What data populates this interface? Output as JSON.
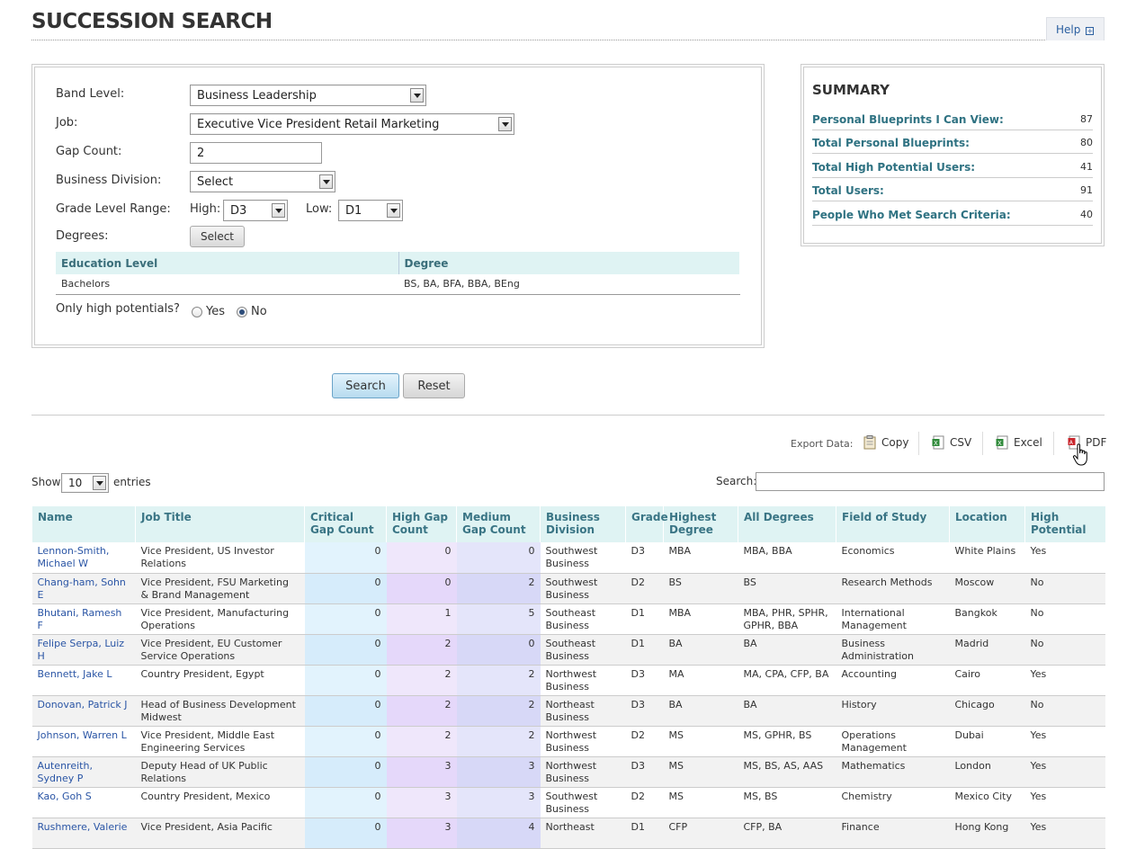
{
  "header": {
    "title": "SUCCESSION SEARCH",
    "help_label": "Help"
  },
  "form": {
    "band_level": {
      "label": "Band Level:",
      "value": "Business Leadership"
    },
    "job": {
      "label": "Job:",
      "value": "Executive Vice President Retail Marketing"
    },
    "gap_count": {
      "label": "Gap Count:",
      "value": "2"
    },
    "business_division": {
      "label": "Business Division:",
      "value": "Select"
    },
    "grade_level_range": {
      "label": "Grade Level Range:",
      "high_label": "High:",
      "high_value": "D3",
      "low_label": "Low:",
      "low_value": "D1"
    },
    "degrees": {
      "label": "Degrees:",
      "button": "Select"
    },
    "education_table": {
      "headers": [
        "Education Level",
        "Degree"
      ],
      "rows": [
        [
          "Bachelors",
          "BS, BA, BFA, BBA, BEng"
        ]
      ]
    },
    "high_potentials": {
      "label": "Only high potentials?",
      "yes": "Yes",
      "no": "No",
      "selected": "No"
    }
  },
  "summary": {
    "title": "SUMMARY",
    "rows": [
      {
        "label": "Personal Blueprints I Can View:",
        "value": "87"
      },
      {
        "label": "Total Personal Blueprints:",
        "value": "80"
      },
      {
        "label": "Total High Potential Users:",
        "value": "41"
      },
      {
        "label": "Total Users:",
        "value": "91"
      },
      {
        "label": "People Who Met Search Criteria:",
        "value": "40"
      }
    ]
  },
  "actions": {
    "search": "Search",
    "reset": "Reset"
  },
  "export": {
    "label": "Export Data:",
    "copy": "Copy",
    "csv": "CSV",
    "excel": "Excel",
    "pdf": "PDF"
  },
  "table_controls": {
    "show": "Show",
    "entries_value": "10",
    "entries": "entries",
    "search_label": "Search:"
  },
  "results": {
    "headers": [
      "Name",
      "Job Title",
      "Critical Gap Count",
      "High Gap Count",
      "Medium Gap Count",
      "Business Division",
      "Grade",
      "Highest Degree",
      "All Degrees",
      "Field of Study",
      "Location",
      "High Potential"
    ],
    "rows": [
      [
        "Lennon-Smith, Michael W",
        "Vice President, US Investor Relations",
        "0",
        "0",
        "0",
        "Southwest Business",
        "D3",
        "MBA",
        "MBA, BBA",
        "Economics",
        "White Plains",
        "Yes"
      ],
      [
        "Chang-ham, Sohn E",
        "Vice President, FSU Marketing & Brand Management",
        "0",
        "0",
        "2",
        "Southwest Business",
        "D2",
        "BS",
        "BS",
        "Research Methods",
        "Moscow",
        "No"
      ],
      [
        "Bhutani, Ramesh F",
        "Vice President, Manufacturing Operations",
        "0",
        "1",
        "5",
        "Southeast Business",
        "D1",
        "MBA",
        "MBA, PHR, SPHR, GPHR, BBA",
        "International Management",
        "Bangkok",
        "No"
      ],
      [
        "Felipe Serpa, Luiz H",
        "Vice President, EU Customer Service Operations",
        "0",
        "2",
        "0",
        "Southeast Business",
        "D1",
        "BA",
        "BA",
        "Business Administration",
        "Madrid",
        "No"
      ],
      [
        "Bennett, Jake L",
        "Country President, Egypt",
        "0",
        "2",
        "2",
        "Northwest Business",
        "D3",
        "MA",
        "MA, CPA, CFP, BA",
        "Accounting",
        "Cairo",
        "Yes"
      ],
      [
        "Donovan, Patrick J",
        "Head of Business Development Midwest",
        "0",
        "2",
        "2",
        "Northeast Business",
        "D3",
        "BA",
        "BA",
        "History",
        "Chicago",
        "No"
      ],
      [
        "Johnson, Warren L",
        "Vice President, Middle East Engineering Services",
        "0",
        "2",
        "2",
        "Northwest Business",
        "D2",
        "MS",
        "MS, GPHR, BS",
        "Operations Management",
        "Dubai",
        "Yes"
      ],
      [
        "Autenreith, Sydney P",
        "Deputy Head of UK Public Relations",
        "0",
        "3",
        "3",
        "Northwest Business",
        "D3",
        "MS",
        "MS, BS, AS, AAS",
        "Mathematics",
        "London",
        "Yes"
      ],
      [
        "Kao, Goh S",
        "Country President, Mexico",
        "0",
        "3",
        "3",
        "Southwest Business",
        "D2",
        "MS",
        "MS, BS",
        "Chemistry",
        "Mexico City",
        "Yes"
      ],
      [
        "Rushmere, Valerie",
        "Vice President, Asia Pacific",
        "0",
        "3",
        "4",
        "Northeast",
        "D1",
        "CFP",
        "CFP, BA",
        "Finance",
        "Hong Kong",
        "Yes"
      ]
    ]
  }
}
